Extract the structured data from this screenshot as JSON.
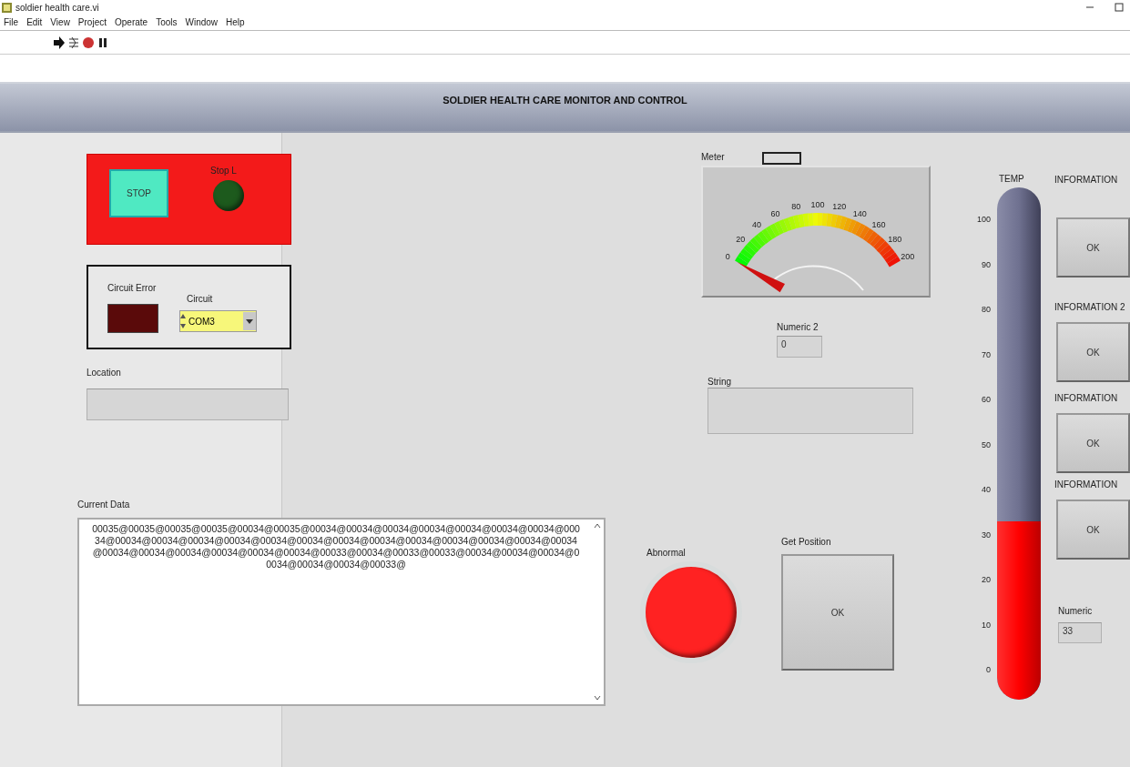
{
  "window": {
    "title": "soldier health care.vi"
  },
  "menu": [
    "File",
    "Edit",
    "View",
    "Project",
    "Operate",
    "Tools",
    "Window",
    "Help"
  ],
  "banner": {
    "title": "SOLDIER HEALTH CARE MONITOR AND CONTROL"
  },
  "stop_panel": {
    "button": "STOP",
    "led": {
      "label": "Stop L",
      "on": false
    }
  },
  "circuit": {
    "error_led": {
      "label": "Circuit Error",
      "on": false
    },
    "selector": {
      "label": "Circuit",
      "value": "COM3"
    }
  },
  "location": {
    "label": "Location"
  },
  "current_data": {
    "label": "Current Data",
    "value": "00035@00035@00035@00035@00034@00035@00034@00034@00034@00034@00034@00034@00034@00034@00034@00034@00034@00034@00034@00034@00034@00034@00034@00034@00034@00034@00034@00034@00034@00034@00034@00034@00034@00033@00034@00033@00033@00034@00034@00034@00034@00034@00034@00033@"
  },
  "meter": {
    "label": "Meter",
    "scale": [
      "0",
      "20",
      "40",
      "60",
      "80",
      "100",
      "120",
      "140",
      "160",
      "180",
      "200"
    ]
  },
  "numeric2": {
    "label": "Numeric 2",
    "value": "0"
  },
  "string": {
    "label": "String"
  },
  "abnormal": {
    "label": "Abnormal",
    "on": true
  },
  "get_position": {
    "label": "Get Position",
    "button": "OK"
  },
  "thermometer": {
    "label": "TEMP",
    "level": 0.33,
    "scale": [
      "100",
      "90",
      "80",
      "70",
      "60",
      "50",
      "40",
      "30",
      "20",
      "10",
      "0"
    ]
  },
  "info_buttons": [
    {
      "label": "INFORMATION",
      "button": "OK"
    },
    {
      "label": "INFORMATION 2",
      "button": "OK"
    },
    {
      "label": "INFORMATION",
      "button": "OK"
    },
    {
      "label": "INFORMATION",
      "button": "OK"
    }
  ],
  "numeric": {
    "label": "Numeric",
    "value": "33"
  }
}
